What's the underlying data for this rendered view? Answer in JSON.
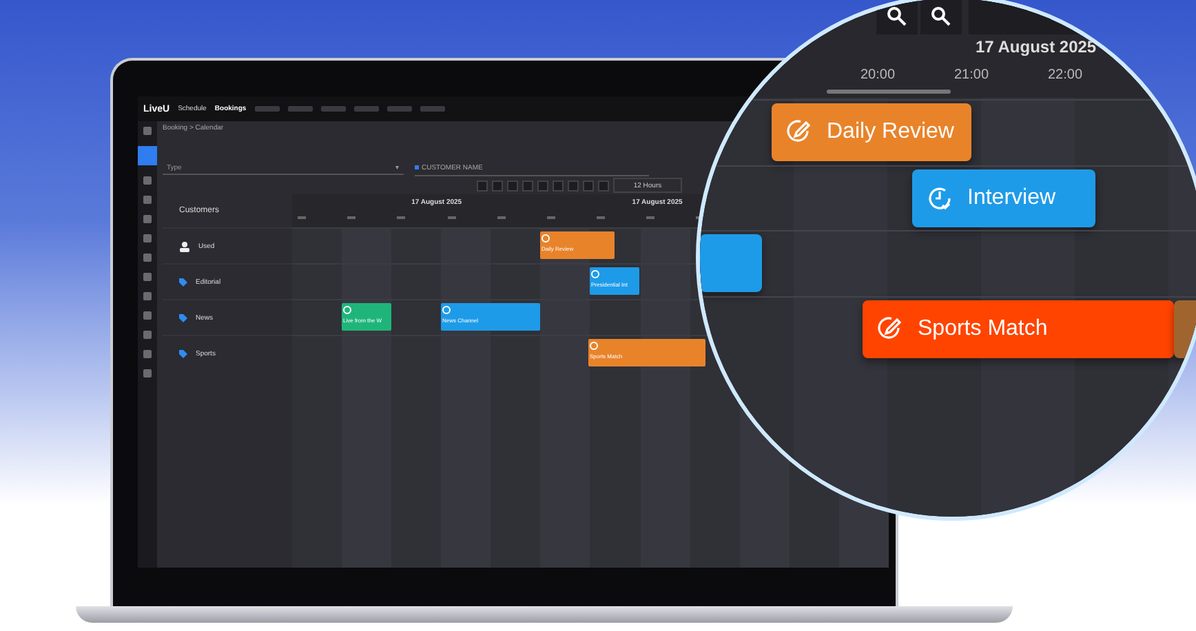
{
  "app": {
    "logo": "LiveU",
    "product": "Schedule",
    "nav": [
      {
        "label": "Bookings",
        "selected": true
      }
    ]
  },
  "breadcrumb": "Booking > Calendar",
  "filters": {
    "type_placeholder": "Type",
    "caret": "▾",
    "chips": [
      "CUSTOMER NAME"
    ]
  },
  "range": "12 Hours",
  "customers_title": "Customers",
  "dates": [
    "17 August 2025",
    "17 August 2025"
  ],
  "resources": [
    {
      "name": "Used",
      "kind": "user",
      "events": [
        {
          "title": "Daily Review",
          "color": "#e8832a"
        }
      ]
    },
    {
      "name": "Editorial",
      "kind": "tag",
      "events": [
        {
          "title": "Presidential Int",
          "color": "#1e9be8"
        }
      ]
    },
    {
      "name": "News",
      "kind": "tag",
      "events": [
        {
          "title": "Live from the W",
          "color": "#1fb57a"
        },
        {
          "title": "News Channel",
          "color": "#1e9be8"
        }
      ]
    },
    {
      "name": "Sports",
      "kind": "tag",
      "events": [
        {
          "title": "Sports Match",
          "color": "#e8832a"
        }
      ]
    }
  ],
  "lens": {
    "date": "17 August 2025",
    "hours": [
      "20:00",
      "21:00",
      "22:00"
    ],
    "rows": [
      {
        "events": [
          {
            "title": "Daily Review",
            "color": "#e8832a",
            "kind": "edit"
          }
        ]
      },
      {
        "events": [
          {
            "title": "Interview",
            "color": "#1e9be8",
            "kind": "clock"
          }
        ]
      },
      {
        "events": [
          {
            "color": "#1e9be8",
            "kind": "plain"
          }
        ]
      },
      {
        "events": [
          {
            "title": "Sports Match",
            "color": "#ff4400",
            "kind": "edit"
          },
          {
            "color": "#a0652e",
            "kind": "plain"
          }
        ]
      }
    ]
  }
}
